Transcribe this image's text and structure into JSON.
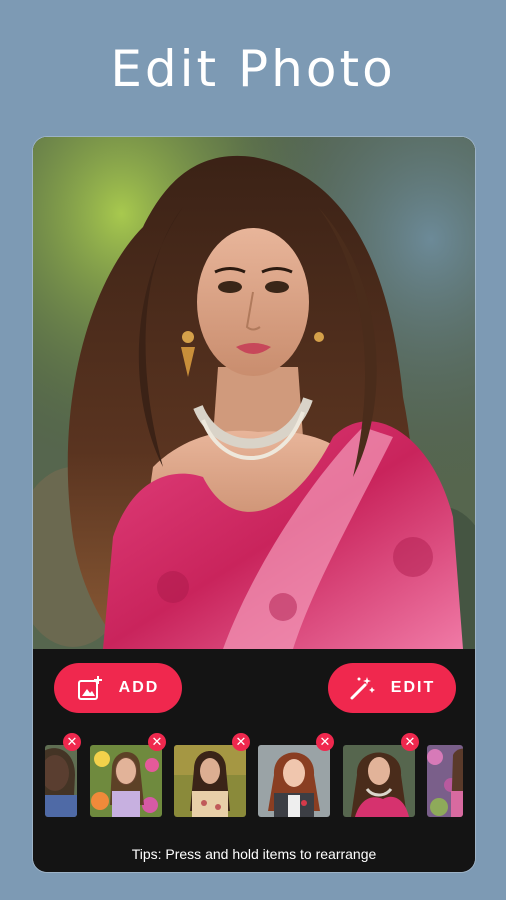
{
  "header": {
    "title": "Edit Photo"
  },
  "actions": {
    "add_label": "ADD",
    "edit_label": "EDIT"
  },
  "tips": "Tips: Press and hold items to rearrange",
  "colors": {
    "background": "#7d9ab4",
    "accent": "#f0284e",
    "panel": "#141414"
  },
  "thumbnails": [
    {
      "name": "thumb-1",
      "removable": true
    },
    {
      "name": "thumb-2",
      "removable": true
    },
    {
      "name": "thumb-3",
      "removable": true
    },
    {
      "name": "thumb-4",
      "removable": true
    },
    {
      "name": "thumb-5",
      "removable": true
    },
    {
      "name": "thumb-6",
      "removable": false
    }
  ],
  "icons": {
    "add": "add-photo-icon",
    "edit": "magic-wand-icon",
    "remove": "close-icon"
  }
}
